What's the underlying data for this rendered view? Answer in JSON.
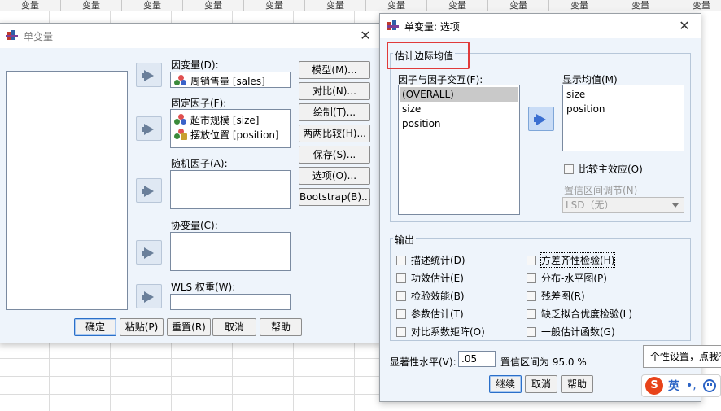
{
  "sheet": {
    "column_header": "变量"
  },
  "main_dialog": {
    "title": "单变量",
    "dependent_label": "因变量(D):",
    "dependent_value": "周销售量 [sales]",
    "fixed_label": "固定因子(F):",
    "fixed_items": [
      "超市规模 [size]",
      "摆放位置 [position]"
    ],
    "random_label": "随机因子(A):",
    "covariate_label": "协变量(C):",
    "wls_label": "WLS 权重(W):",
    "side_buttons": [
      "模型(M)...",
      "对比(N)...",
      "绘制(T)...",
      "两两比较(H)...",
      "保存(S)...",
      "选项(O)...",
      "Bootstrap(B)..."
    ],
    "bottom_buttons": [
      "确定",
      "粘贴(P)",
      "重置(R)",
      "取消",
      "帮助"
    ]
  },
  "options_dialog": {
    "title": "单变量: 选项",
    "group_emm_title": "估计边际均值",
    "factors_label": "因子与因子交互(F):",
    "factors_items": [
      "(OVERALL)",
      "size",
      "position"
    ],
    "display_label": "显示均值(M)",
    "display_items": [
      "size",
      "position"
    ],
    "compare_main": "比较主效应(O)",
    "ci_adjust_label": "置信区间调节(N)",
    "ci_adjust_value": "LSD（无）",
    "group_output_title": "输出",
    "output_left": [
      "描述统计(D)",
      "功效估计(E)",
      "检验效能(B)",
      "参数估计(T)",
      "对比系数矩阵(O)"
    ],
    "output_right": [
      "方差齐性检验(H)",
      "分布-水平图(P)",
      "残差图(R)",
      "缺乏拟合优度检验(L)",
      "一般估计函数(G)"
    ],
    "sig_label": "显著性水平(V):",
    "sig_value": ".05",
    "ci_text": "置信区间为 95.0 %",
    "buttons": [
      "继续",
      "取消",
      "帮助"
    ]
  },
  "tooltip": {
    "text": "个性设置，点我有"
  },
  "ime": {
    "logo": "S",
    "lang": "英",
    "punct": "•,"
  },
  "colors": {
    "dialog_body": "#eef4fb",
    "highlight": "#e03a3a",
    "ime_logo": "#e8431a"
  }
}
